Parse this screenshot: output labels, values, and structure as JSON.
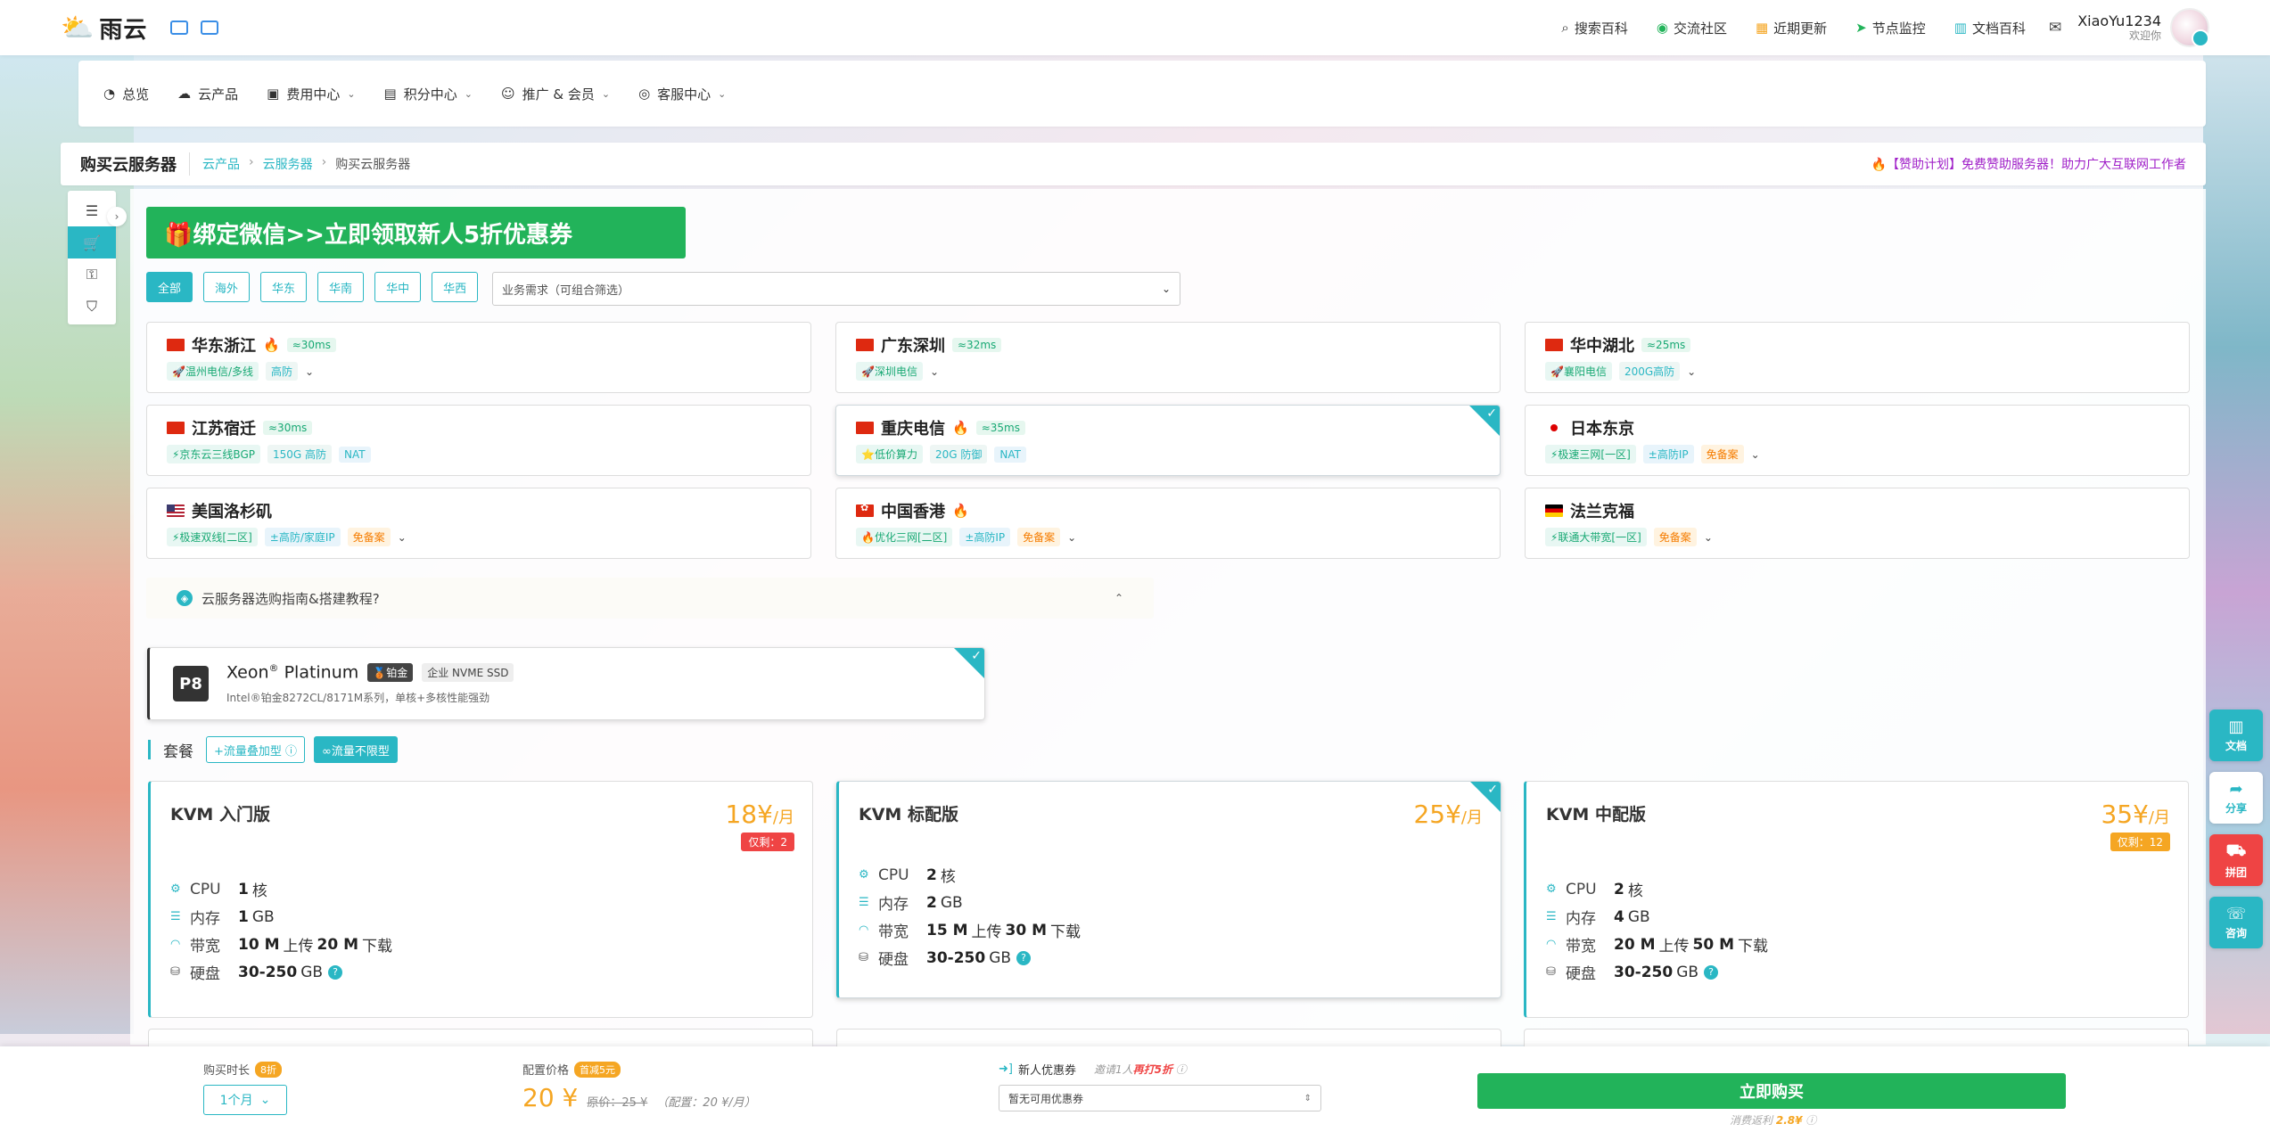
{
  "topbar": {
    "logo_text": "雨云",
    "links": [
      {
        "icon": "search-icon",
        "glyph": "⌕",
        "label": "搜索百科",
        "color": "#333333"
      },
      {
        "icon": "wechat-icon",
        "glyph": "◉",
        "label": "交流社区",
        "color": "#22b35a"
      },
      {
        "icon": "calendar-icon",
        "glyph": "▦",
        "label": "近期更新",
        "color": "#f5a623"
      },
      {
        "icon": "send-icon",
        "glyph": "➤",
        "label": "节点监控",
        "color": "#22b35a"
      },
      {
        "icon": "book-icon",
        "glyph": "▥",
        "label": "文档百科",
        "color": "#2ab7c4"
      }
    ],
    "mail_icon": "mail-icon",
    "username": "XiaoYu1234",
    "welcome": "欢迎你"
  },
  "nav": [
    {
      "label": "总览",
      "glyph": "◔",
      "caret": false
    },
    {
      "label": "云产品",
      "glyph": "☁",
      "caret": false
    },
    {
      "label": "费用中心",
      "glyph": "▣",
      "caret": true
    },
    {
      "label": "积分中心",
      "glyph": "▤",
      "caret": true
    },
    {
      "label": "推广 & 会员",
      "glyph": "☺",
      "caret": true
    },
    {
      "label": "客服中心",
      "glyph": "◎",
      "caret": true
    }
  ],
  "breadcrumb": {
    "title": "购买云服务器",
    "items": [
      "云产品",
      "云服务器",
      "购买云服务器"
    ],
    "promo": "🔥【赞助计划】免费赞助服务器！助力广大互联网工作者"
  },
  "banner": {
    "text": "🎁绑定微信>>立即领取新人5折优惠券"
  },
  "filters": {
    "regions": [
      "全部",
      "海外",
      "华东",
      "华南",
      "华中",
      "华西"
    ],
    "active_index": 0,
    "need_placeholder": "业务需求（可组合筛选）"
  },
  "regions": [
    {
      "flag": "cn",
      "name": "华东浙江",
      "hot": true,
      "latency": "≈30ms",
      "tags": [
        {
          "t": "🚀温州电信/多线",
          "c": "green"
        },
        {
          "t": "高防",
          "c": "gray"
        }
      ],
      "dropdown": true,
      "selected": false
    },
    {
      "flag": "cn",
      "name": "广东深圳",
      "hot": false,
      "latency": "≈32ms",
      "tags": [
        {
          "t": "🚀深圳电信",
          "c": "green"
        }
      ],
      "dropdown": true,
      "selected": false
    },
    {
      "flag": "cn",
      "name": "华中湖北",
      "hot": false,
      "latency": "≈25ms",
      "tags": [
        {
          "t": "🚀襄阳电信",
          "c": "green"
        },
        {
          "t": "200G高防",
          "c": "gray"
        }
      ],
      "dropdown": true,
      "selected": false
    },
    {
      "flag": "cn",
      "name": "江苏宿迁",
      "hot": false,
      "latency": "≈30ms",
      "tags": [
        {
          "t": "⚡京东云三线BGP",
          "c": "green"
        },
        {
          "t": "150G 高防",
          "c": "gray"
        },
        {
          "t": "NAT",
          "c": "blue"
        }
      ],
      "dropdown": false,
      "selected": false
    },
    {
      "flag": "cn",
      "name": "重庆电信",
      "hot": true,
      "latency": "≈35ms",
      "tags": [
        {
          "t": "⭐低价算力",
          "c": "green"
        },
        {
          "t": "20G 防御",
          "c": "gray"
        },
        {
          "t": "NAT",
          "c": "blue"
        }
      ],
      "dropdown": false,
      "selected": true
    },
    {
      "flag": "jp",
      "name": "日本东京",
      "hot": false,
      "latency": "",
      "tags": [
        {
          "t": "⚡极速三网[一区]",
          "c": "green"
        },
        {
          "t": "±高防IP",
          "c": "blue"
        },
        {
          "t": "免备案",
          "c": "orange"
        }
      ],
      "dropdown": true,
      "selected": false
    },
    {
      "flag": "us",
      "name": "美国洛杉矶",
      "hot": false,
      "latency": "",
      "tags": [
        {
          "t": "⚡极速双线[二区]",
          "c": "green"
        },
        {
          "t": "±高防/家庭IP",
          "c": "blue"
        },
        {
          "t": "免备案",
          "c": "orange"
        }
      ],
      "dropdown": true,
      "selected": false
    },
    {
      "flag": "hk",
      "name": "中国香港",
      "hot": true,
      "latency": "",
      "tags": [
        {
          "t": "🔥优化三网[二区]",
          "c": "green"
        },
        {
          "t": "±高防IP",
          "c": "blue"
        },
        {
          "t": "免备案",
          "c": "orange"
        }
      ],
      "dropdown": true,
      "selected": false
    },
    {
      "flag": "de",
      "name": "法兰克福",
      "hot": false,
      "latency": "",
      "tags": [
        {
          "t": "⚡联通大带宽[一区]",
          "c": "green"
        },
        {
          "t": "免备案",
          "c": "orange"
        }
      ],
      "dropdown": true,
      "selected": false
    }
  ],
  "guide": {
    "text": "云服务器选购指南&搭建教程?"
  },
  "cpu": {
    "badge": "P8",
    "name": "Xeon",
    "sup": "®",
    "name2": "Platinum",
    "tier": "🥉铂金",
    "disk": "企业 NVME SSD",
    "desc": "Intel®铂金8272CL/8171M系列，单核+多核性能强劲"
  },
  "package": {
    "title": "套餐",
    "types": [
      {
        "label": "+流量叠加型 ⓘ",
        "active": false
      },
      {
        "label": "∞流量不限型",
        "active": true
      }
    ]
  },
  "plans": [
    {
      "name": "KVM 入门版",
      "price": "18¥",
      "unit": "/月",
      "remain": "仅剩：2",
      "remain_color": "red",
      "selected": false,
      "specs": {
        "cpu": "1",
        "cpu_unit": "核",
        "mem": "1",
        "mem_unit": "GB",
        "bw_up": "10 M",
        "bw_up_label": "上传",
        "bw_down": "20 M",
        "bw_down_label": "下载",
        "disk": "30-250",
        "disk_unit": "GB"
      }
    },
    {
      "name": "KVM 标配版",
      "price": "25¥",
      "unit": "/月",
      "remain": "",
      "remain_color": "",
      "selected": true,
      "specs": {
        "cpu": "2",
        "cpu_unit": "核",
        "mem": "2",
        "mem_unit": "GB",
        "bw_up": "15 M",
        "bw_up_label": "上传",
        "bw_down": "30 M",
        "bw_down_label": "下载",
        "disk": "30-250",
        "disk_unit": "GB"
      }
    },
    {
      "name": "KVM 中配版",
      "price": "35¥",
      "unit": "/月",
      "remain": "仅剩：12",
      "remain_color": "orange",
      "selected": false,
      "specs": {
        "cpu": "2",
        "cpu_unit": "核",
        "mem": "4",
        "mem_unit": "GB",
        "bw_up": "20 M",
        "bw_up_label": "上传",
        "bw_down": "50 M",
        "bw_down_label": "下载",
        "disk": "30-250",
        "disk_unit": "GB"
      }
    }
  ],
  "spec_labels": {
    "cpu": "CPU",
    "mem": "内存",
    "bw": "带宽",
    "disk": "硬盘"
  },
  "float_tools": [
    {
      "label": "文档",
      "icon": "book-icon",
      "glyph": "▥",
      "style": "teal"
    },
    {
      "label": "分享",
      "icon": "share-icon",
      "glyph": "➦",
      "style": "white"
    },
    {
      "label": "拼团",
      "icon": "cart-icon",
      "glyph": "⛟",
      "style": "red"
    },
    {
      "label": "咨询",
      "icon": "headset-icon",
      "glyph": "☏",
      "style": "teal"
    }
  ],
  "buybar": {
    "duration_label": "购买时长",
    "duration_badge": "8折",
    "duration_value": "1个月",
    "config_label": "配置价格",
    "config_badge": "首减5元",
    "config_price": "20 ¥",
    "original_price": "原价：25 ¥",
    "config_note": "（配置：20 ¥/月）",
    "coupon_label": "新人优惠券",
    "invite_prefix": "邀请1人",
    "invite_highlight": "再打5折",
    "coupon_placeholder": "暂无可用优惠券",
    "buy_label": "立即购买",
    "profit_prefix": "消费返利",
    "profit_value": "2.8¥"
  }
}
